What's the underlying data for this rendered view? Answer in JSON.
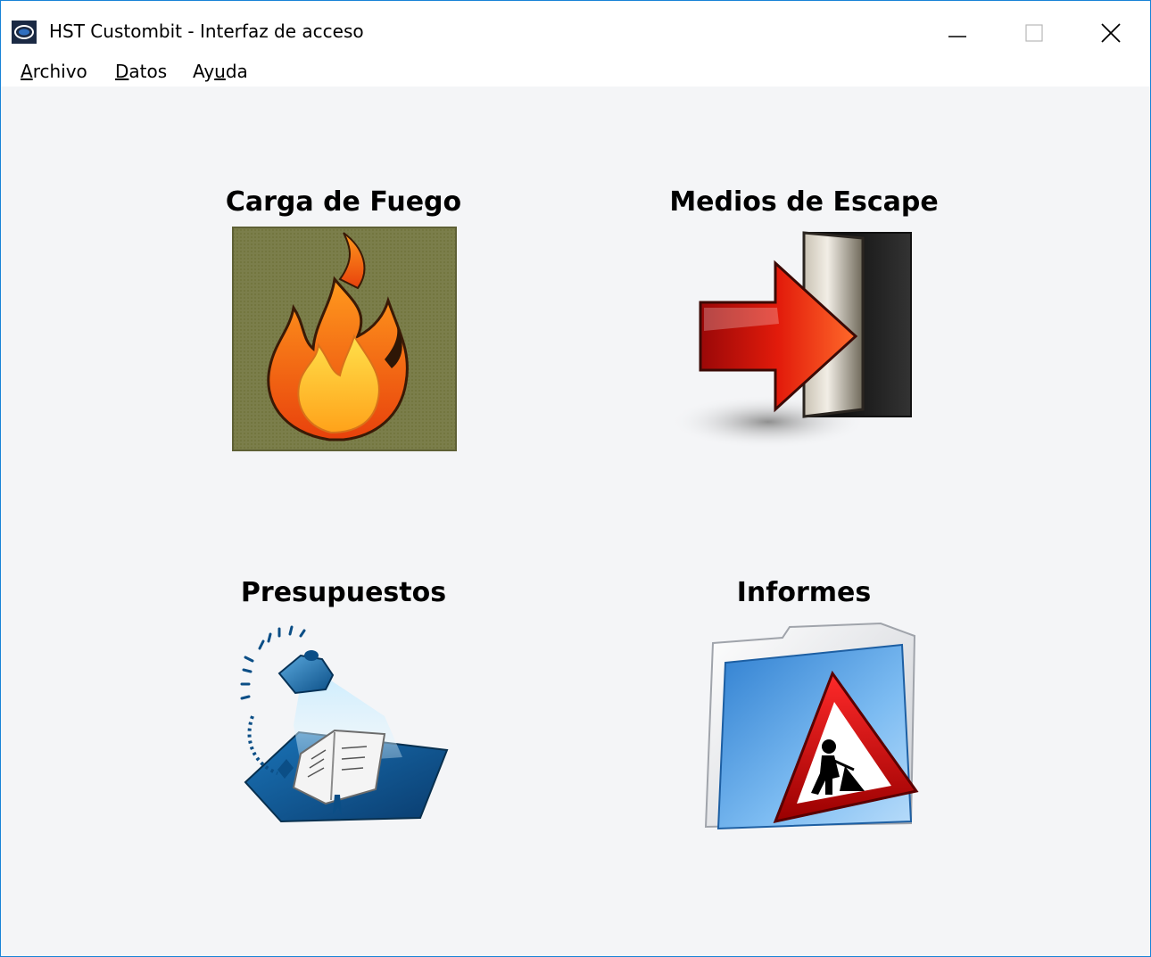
{
  "window": {
    "title": "HST Custombit - Interfaz de acceso",
    "border_color": "#1883d7",
    "controls": {
      "minimize_icon": "minimize-icon",
      "maximize_icon": "maximize-icon",
      "close_icon": "close-icon"
    }
  },
  "menubar": {
    "items": [
      {
        "accel": "A",
        "rest": "rchivo"
      },
      {
        "accel": "D",
        "rest": "atos"
      },
      {
        "pre": "Ay",
        "accel": "u",
        "rest": "da"
      }
    ]
  },
  "tiles": [
    {
      "label": "Carga de Fuego",
      "icon": "flame-icon"
    },
    {
      "label": "Medios de Escape",
      "icon": "exit-door-icon"
    },
    {
      "label": "Presupuestos",
      "icon": "lamp-book-icon"
    },
    {
      "label": "Informes",
      "icon": "folder-warning-icon"
    }
  ]
}
